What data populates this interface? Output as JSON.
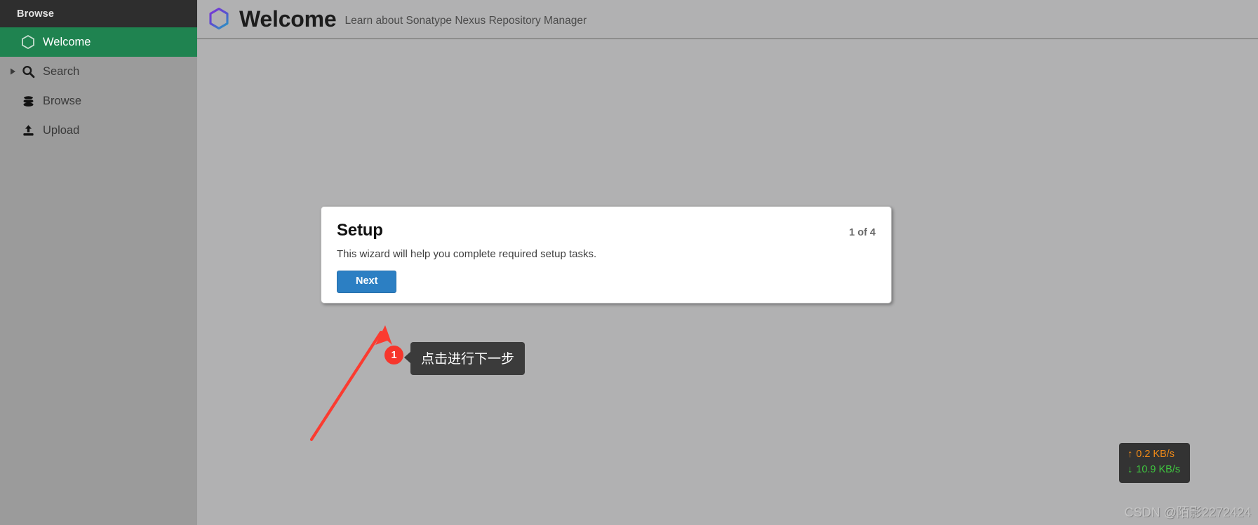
{
  "sidebar": {
    "header_label": "Browse",
    "items": [
      {
        "label": "Welcome",
        "icon": "hexagon-icon",
        "selected": true,
        "has_caret": false
      },
      {
        "label": "Search",
        "icon": "magnifier-icon",
        "selected": false,
        "has_caret": true
      },
      {
        "label": "Browse",
        "icon": "database-icon",
        "selected": false,
        "has_caret": false
      },
      {
        "label": "Upload",
        "icon": "upload-icon",
        "selected": false,
        "has_caret": false
      }
    ]
  },
  "header": {
    "icon": "nexus-hexagon-icon",
    "title": "Welcome",
    "subtitle": "Learn about Sonatype Nexus Repository Manager"
  },
  "modal": {
    "title": "Setup",
    "step_indicator": "1 of 4",
    "description": "This wizard will help you complete required setup tasks.",
    "next_label": "Next"
  },
  "annotation": {
    "badge_number": "1",
    "tooltip_text": "点击进行下一步",
    "arrow_color": "#fb3b30"
  },
  "netspeed": {
    "upload_arrow": "↑",
    "upload_value": "0.2 KB/s",
    "download_arrow": "↓",
    "download_value": "10.9 KB/s",
    "upload_color": "#f08a18",
    "download_color": "#3fc63f"
  },
  "watermark": {
    "text": "CSDN @陌影2272424"
  },
  "colors": {
    "accent_green": "#1f8350",
    "accent_blue": "#2c7fc3",
    "sidebar_bg": "#9b9b9b",
    "sidebar_header_bg": "#2e2e2e",
    "page_bg": "#b1b1b2"
  }
}
